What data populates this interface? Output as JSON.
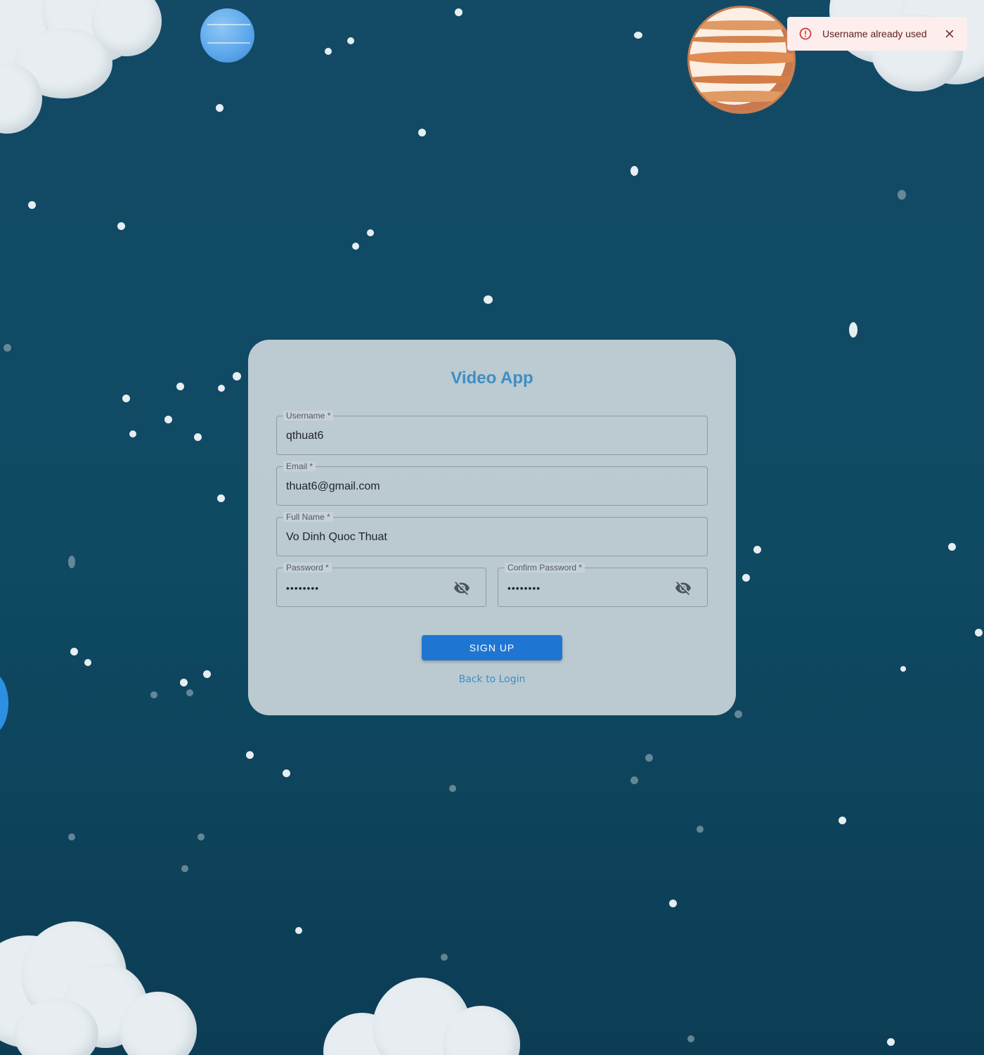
{
  "app": {
    "title": "Video App"
  },
  "form": {
    "username": {
      "label": "Username *",
      "value": "qthuat6"
    },
    "email": {
      "label": "Email *",
      "value": "thuat6@gmail.com"
    },
    "full_name": {
      "label": "Full Name *",
      "value": "Vo Dinh Quoc Thuat"
    },
    "password": {
      "label": "Password *",
      "value": "••••••••",
      "toggle_icon": "eye-off-icon"
    },
    "confirm_password": {
      "label": "Confirm Password *",
      "value": "••••••••",
      "toggle_icon": "eye-off-icon"
    },
    "submit_label": "SIGN UP",
    "back_link": "Back to Login"
  },
  "toast": {
    "message": "Username already used",
    "severity": "error",
    "icon": "error-outline-icon",
    "close_icon": "close-icon"
  },
  "colors": {
    "background": "#0f4a63",
    "card": "#c7d2d8",
    "accent": "#3d8ec4",
    "button": "#1f76d2",
    "toast_bg": "#fdeded",
    "toast_text": "#5f2120",
    "toast_icon": "#d32f2f"
  }
}
